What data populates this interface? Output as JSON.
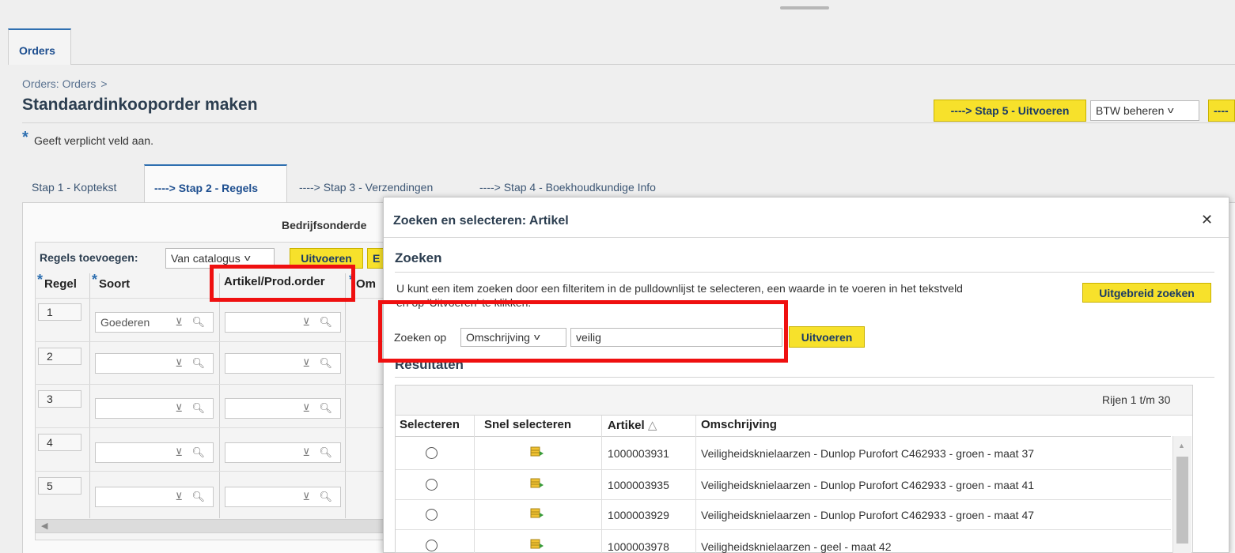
{
  "top_tab": {
    "label": "Orders"
  },
  "breadcrumb": {
    "link": "Orders: Orders",
    "separator": ">"
  },
  "page_title": "Standaardinkooporder maken",
  "header_actions": {
    "step5_label": "----> Stap 5 - Uitvoeren",
    "btw_label": "BTW beheren",
    "next_label": "----"
  },
  "required_note": {
    "star": "*",
    "text": "Geeft verplicht veld aan."
  },
  "step_tabs": [
    {
      "label": "Stap 1 - Koptekst"
    },
    {
      "label": "----> Stap 2 - Regels"
    },
    {
      "label": "----> Stap 3 - Verzendingen"
    },
    {
      "label": "----> Stap 4 - Boekhoudkundige Info"
    }
  ],
  "lines": {
    "section_label": "Bedrijfsonderde",
    "add_label": "Regels toevoegen:",
    "add_select": "Van catalogus",
    "execute_label": "Uitvoeren",
    "next_button_partial": "E",
    "columns": {
      "regel": "Regel",
      "soort": "Soort",
      "artikel": "Artikel/Prod.order",
      "om": "Om"
    },
    "rows": [
      {
        "regel": "1",
        "soort": "Goederen",
        "artikel": ""
      },
      {
        "regel": "2",
        "soort": "",
        "artikel": ""
      },
      {
        "regel": "3",
        "soort": "",
        "artikel": ""
      },
      {
        "regel": "4",
        "soort": "",
        "artikel": ""
      },
      {
        "regel": "5",
        "soort": "",
        "artikel": ""
      }
    ]
  },
  "dialog": {
    "title": "Zoeken en selecteren: Artikel",
    "close_glyph": "✕",
    "search_heading": "Zoeken",
    "instruction_line1": "U kunt een item zoeken door een filteritem in de pulldownlijst te selecteren, een waarde in te voeren in het tekstveld",
    "instruction_line2": "en op 'Uitvoeren' te klikken.",
    "advanced_search_label": "Uitgebreid zoeken",
    "search_by_label": "Zoeken op",
    "search_by_value": "Omschrijving",
    "search_value": "veilig",
    "execute_label": "Uitvoeren",
    "results_heading": "Resultaten",
    "rows_range": "Rijen 1 t/m 30",
    "columns": {
      "select": "Selecteren",
      "quick_select": "Snel selecteren",
      "item": "Artikel",
      "description": "Omschrijving"
    },
    "results": [
      {
        "item": "1000003931",
        "description": "Veiligheidsknielaarzen - Dunlop Purofort C462933 - groen - maat 37"
      },
      {
        "item": "1000003935",
        "description": "Veiligheidsknielaarzen - Dunlop Purofort C462933 - groen - maat 41"
      },
      {
        "item": "1000003929",
        "description": "Veiligheidsknielaarzen - Dunlop Purofort C462933 - groen - maat 47"
      },
      {
        "item": "1000003978",
        "description": "Veiligheidsknielaarzen - geel - maat 42"
      }
    ]
  },
  "colors": {
    "accent_blue": "#2e6fb0",
    "button_yellow": "#f7e12b",
    "highlight_red": "#ef1010"
  },
  "icons": {
    "lov": "lov-dropdown-icon",
    "search": "search-icon",
    "quick_select": "quick-select-icon",
    "sort": "sort-ascending-icon",
    "close": "close-icon"
  }
}
